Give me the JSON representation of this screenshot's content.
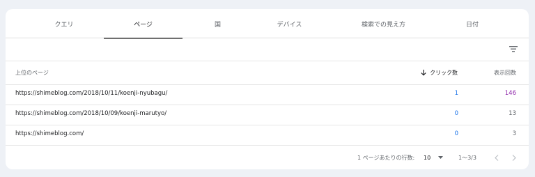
{
  "tabs": [
    {
      "label": "クエリ"
    },
    {
      "label": "ページ"
    },
    {
      "label": "国"
    },
    {
      "label": "デバイス"
    },
    {
      "label": "検索での見え方"
    },
    {
      "label": "日付"
    }
  ],
  "active_tab": "ページ",
  "table": {
    "columns": {
      "page": "上位のページ",
      "clicks": "クリック数",
      "impressions": "表示回数"
    },
    "sort": {
      "column": "clicks",
      "direction": "descending"
    },
    "rows": [
      {
        "url": "https://shimeblog.com/2018/10/11/koenji-nyubagu/",
        "clicks": "1",
        "impressions": "146"
      },
      {
        "url": "https://shimeblog.com/2018/10/09/koenji-marutyo/",
        "clicks": "0",
        "impressions": "13"
      },
      {
        "url": "https://shimeblog.com/",
        "clicks": "0",
        "impressions": "3"
      }
    ]
  },
  "pagination": {
    "rows_per_page_label": "1 ページあたりの行数:",
    "rows_per_page_value": "10",
    "range": "1～3/3"
  },
  "icons": {
    "filter": "filter-icon",
    "sort": "arrow-down-icon",
    "dropdown": "caret-down-icon",
    "prev": "chevron-left-icon",
    "next": "chevron-right-icon"
  },
  "colors": {
    "background": "#eef1f6",
    "clicks": "#1a73e8",
    "impressions_accent": "#8e24aa",
    "tab_underline": "#6f6f6f"
  }
}
